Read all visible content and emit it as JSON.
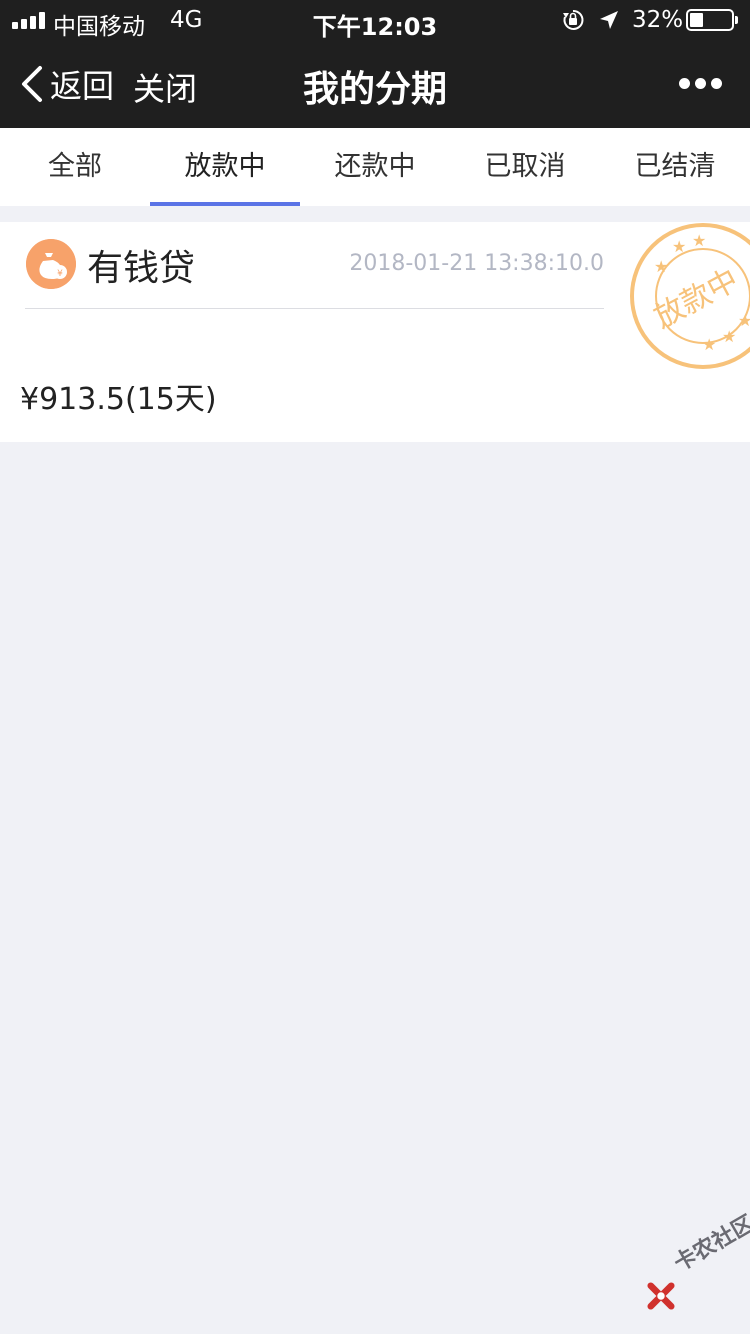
{
  "status_bar": {
    "carrier": "中国移动",
    "network": "4G",
    "time": "下午12:03",
    "battery": "32%",
    "icons": [
      "signal-icon",
      "orientation-lock-icon",
      "location-arrow-icon",
      "battery-icon"
    ]
  },
  "nav": {
    "back_label": "返回",
    "close_label": "关闭",
    "title": "我的分期",
    "more_icon": "more-dots-icon"
  },
  "tabs": [
    {
      "label": "全部"
    },
    {
      "label": "放款中"
    },
    {
      "label": "还款中"
    },
    {
      "label": "已取消"
    },
    {
      "label": "已结清"
    }
  ],
  "active_tab": 1,
  "card": {
    "product": "有钱贷",
    "datetime": "2018-01-21 13:38:10.0",
    "amount": "¥913.5(15天)",
    "stamp_text": "放款中",
    "logo_icon": "money-bag-icon"
  },
  "watermark": {
    "text": "卡农社区"
  },
  "colors": {
    "header_bg": "#1f1f1f",
    "tab_indicator": "#5b74e6",
    "page_bg": "#f0f1f6",
    "stamp": "#f7c27a",
    "logo": "#f7a26a"
  }
}
